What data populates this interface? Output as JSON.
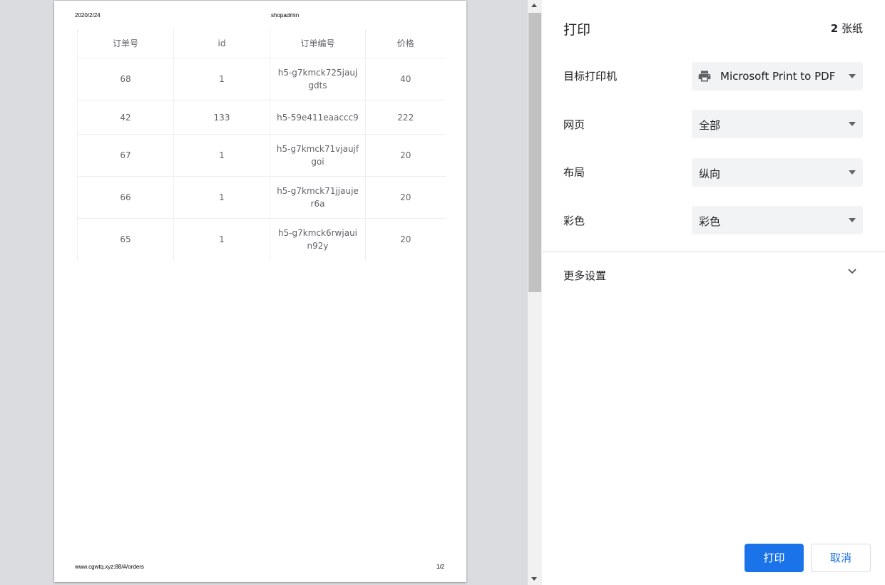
{
  "preview": {
    "header_date": "2020/2/24",
    "header_title": "shopadmin",
    "footer_url": "www.cgwtq.xyz:88/#/orders",
    "footer_page": "1/2",
    "table": {
      "columns": [
        "订单号",
        "id",
        "订单编号",
        "价格"
      ],
      "rows": [
        [
          "68",
          "1",
          "h5-g7kmck725jaujgdts",
          "40"
        ],
        [
          "42",
          "133",
          "h5-59e411eaaccc9",
          "222"
        ],
        [
          "67",
          "1",
          "h5-g7kmck71vjaujfgoi",
          "20"
        ],
        [
          "66",
          "1",
          "h5-g7kmck71jjaujer6a",
          "20"
        ],
        [
          "65",
          "1",
          "h5-g7kmck6rwjauin92y",
          "20"
        ]
      ]
    }
  },
  "panel": {
    "title": "打印",
    "sheet_count_number": "2",
    "sheet_count_unit": " 张纸",
    "destination": {
      "label": "目标打印机",
      "value": "Microsoft Print to PDF",
      "icon": "printer-icon"
    },
    "pages": {
      "label": "网页",
      "value": "全部"
    },
    "layout": {
      "label": "布局",
      "value": "纵向"
    },
    "color": {
      "label": "彩色",
      "value": "彩色"
    },
    "more_settings": "更多设置",
    "print_button": "打印",
    "cancel_button": "取消"
  },
  "colors": {
    "accent": "#1a73e8",
    "select_bg": "#f1f3f4",
    "preview_bg": "#dadce0"
  }
}
